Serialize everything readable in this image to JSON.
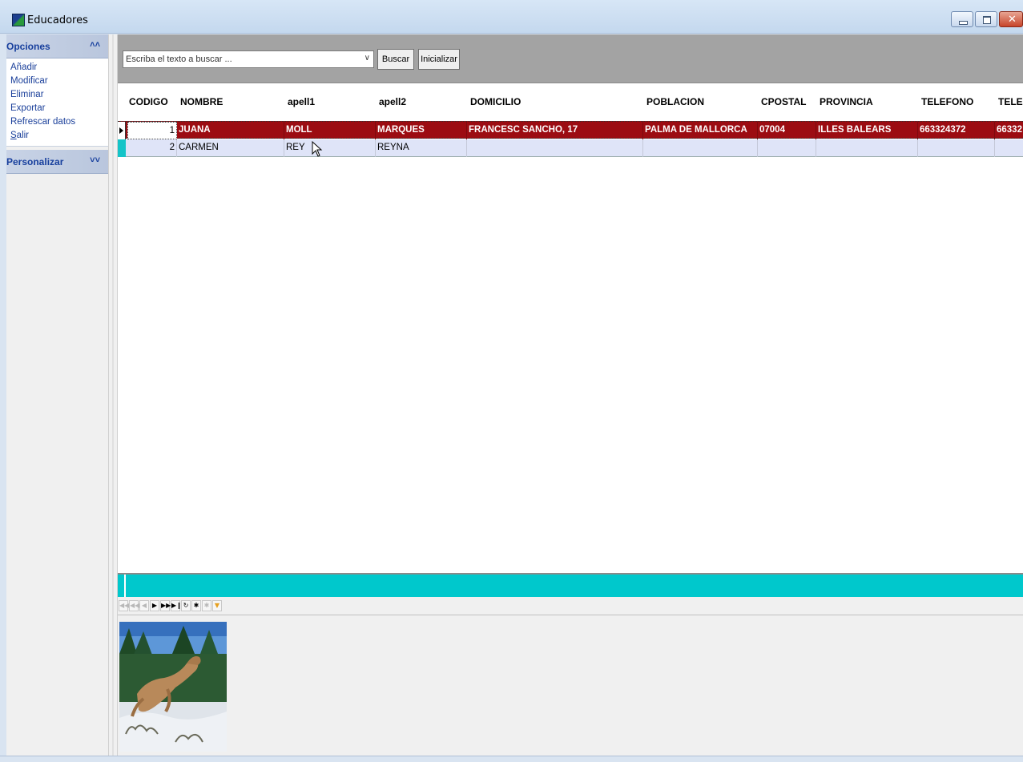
{
  "window": {
    "title": "Educadores"
  },
  "sidebar": {
    "opciones": {
      "title": "Opciones",
      "chevron": "up",
      "items": [
        "Añadir",
        "Modificar",
        "Eliminar",
        "Exportar",
        "Refrescar datos"
      ],
      "salir": {
        "mnemonic": "S",
        "rest": "alir"
      }
    },
    "personalizar": {
      "title": "Personalizar",
      "chevron": "down"
    }
  },
  "toolbar": {
    "search_placeholder": "Escriba el texto a buscar ...",
    "buscar_label": "Buscar",
    "inicializar_label": "Inicializar"
  },
  "grid": {
    "columns": [
      "CODIGO",
      "NOMBRE",
      "apell1",
      "apell2",
      "DOMICILIO",
      "POBLACION",
      "CPOSTAL",
      "PROVINCIA",
      "TELEFONO",
      "TELEF"
    ],
    "rows": [
      {
        "codigo": "1",
        "nombre": "JUANA",
        "apell1": "MOLL",
        "apell2": "MARQUES",
        "domicilio": "FRANCESC SANCHO, 17",
        "poblacion": "PALMA DE MALLORCA",
        "cpostal": "07004",
        "provincia": "ILLES BALEARS",
        "telefono": "663324372",
        "telefono2": "66332"
      },
      {
        "codigo": "2",
        "nombre": "CARMEN",
        "apell1": "REY",
        "apell2": "REYNA",
        "domicilio": "",
        "poblacion": "",
        "cpostal": "",
        "provincia": "",
        "telefono": "",
        "telefono2": ""
      }
    ]
  },
  "navigator": {
    "buttons": [
      "first",
      "prior-page",
      "prior",
      "next",
      "next-page",
      "last",
      "refresh",
      "insert",
      "cancel",
      "filter"
    ]
  },
  "colors": {
    "selected_row": "#9c0c12",
    "alt_row": "#dfe4f8",
    "teal_bar": "#00c8cc",
    "toolbar_bg": "#a3a3a3",
    "sidebar_link": "#1a3f9a"
  }
}
